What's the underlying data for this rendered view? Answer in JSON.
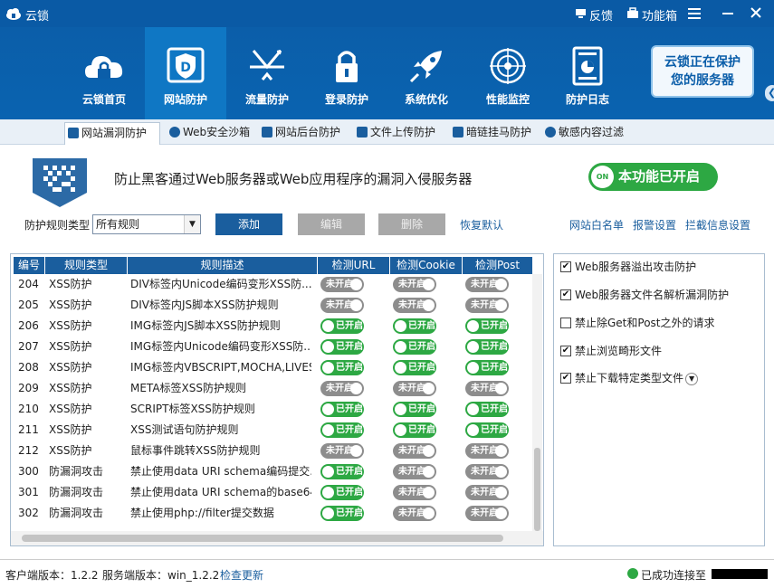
{
  "app": {
    "title": "云锁",
    "feedback": "反馈",
    "toolbox": "功能箱"
  },
  "nav": {
    "items": [
      {
        "label": "云锁首页",
        "icon": "cloud-lock-icon"
      },
      {
        "label": "网站防护",
        "icon": "website-shield-icon"
      },
      {
        "label": "流量防护",
        "icon": "traffic-icon"
      },
      {
        "label": "登录防护",
        "icon": "padlock-icon"
      },
      {
        "label": "系统优化",
        "icon": "rocket-icon"
      },
      {
        "label": "性能监控",
        "icon": "radar-icon"
      },
      {
        "label": "防护日志",
        "icon": "log-report-icon"
      }
    ],
    "protect_line1": "云锁正在保护",
    "protect_line2": "您的服务器"
  },
  "subtabs": [
    {
      "label": "网站漏洞防护"
    },
    {
      "label": "Web安全沙箱"
    },
    {
      "label": "网站后台防护"
    },
    {
      "label": "文件上传防护"
    },
    {
      "label": "暗链挂马防护"
    },
    {
      "label": "敏感内容过滤"
    }
  ],
  "banner": {
    "description": "防止黑客通过Web服务器或Web应用程序的漏洞入侵服务器",
    "toggle_dot": "ON",
    "toggle_label": "本功能已开启"
  },
  "toolbar": {
    "rule_type_label": "防护规则类型",
    "rule_type_value": "所有规则",
    "add": "添加",
    "edit": "编辑",
    "delete": "删除",
    "restore": "恢复默认",
    "whitelist": "网站白名单",
    "report": "报警设置",
    "intercept": "拦截信息设置"
  },
  "table": {
    "headers": [
      "编号",
      "规则类型",
      "规则描述",
      "检测URL",
      "检测Cookie",
      "检测Post"
    ],
    "rows": [
      {
        "id": "204",
        "type": "XSS防护",
        "desc": "DIV标签内Unicode编码变形XSS防...",
        "url": "未开启",
        "cookie": "未开启",
        "post": "未开启"
      },
      {
        "id": "205",
        "type": "XSS防护",
        "desc": "DIV标签内JS脚本XSS防护规则",
        "url": "未开启",
        "cookie": "未开启",
        "post": "未开启"
      },
      {
        "id": "206",
        "type": "XSS防护",
        "desc": "IMG标签内JS脚本XSS防护规则",
        "url": "已开启",
        "cookie": "已开启",
        "post": "已开启"
      },
      {
        "id": "207",
        "type": "XSS防护",
        "desc": "IMG标签内Unicode编码变形XSS防...",
        "url": "已开启",
        "cookie": "已开启",
        "post": "已开启"
      },
      {
        "id": "208",
        "type": "XSS防护",
        "desc": "IMG标签内VBSCRIPT,MOCHA,LIVES...",
        "url": "已开启",
        "cookie": "已开启",
        "post": "已开启"
      },
      {
        "id": "209",
        "type": "XSS防护",
        "desc": "META标签XSS防护规则",
        "url": "未开启",
        "cookie": "未开启",
        "post": "未开启"
      },
      {
        "id": "210",
        "type": "XSS防护",
        "desc": "SCRIPT标签XSS防护规则",
        "url": "已开启",
        "cookie": "已开启",
        "post": "已开启"
      },
      {
        "id": "211",
        "type": "XSS防护",
        "desc": "XSS测试语句防护规则",
        "url": "已开启",
        "cookie": "已开启",
        "post": "已开启"
      },
      {
        "id": "212",
        "type": "XSS防护",
        "desc": "鼠标事件跳转XSS防护规则",
        "url": "未开启",
        "cookie": "未开启",
        "post": "未开启"
      },
      {
        "id": "300",
        "type": "防漏洞攻击",
        "desc": "禁止使用data URI schema编码提交...",
        "url": "已开启",
        "cookie": "未开启",
        "post": "未开启"
      },
      {
        "id": "301",
        "type": "防漏洞攻击",
        "desc": "禁止使用data URI schema的base64...",
        "url": "已开启",
        "cookie": "未开启",
        "post": "未开启"
      },
      {
        "id": "302",
        "type": "防漏洞攻击",
        "desc": "禁止使用php://filter提交数据",
        "url": "已开启",
        "cookie": "未开启",
        "post": "未开启"
      }
    ]
  },
  "options": [
    {
      "label": "Web服务器溢出攻击防护",
      "checked": true
    },
    {
      "label": "Web服务器文件名解析漏洞防护",
      "checked": true
    },
    {
      "label": "禁止除Get和Post之外的请求",
      "checked": false
    },
    {
      "label": "禁止浏览畸形文件",
      "checked": true
    },
    {
      "label": "禁止下载特定类型文件",
      "checked": true
    }
  ],
  "status": {
    "client_version": "客户端版本：1.2.2",
    "server_version": "服务端版本：win_1.2.2",
    "check_update": "检查更新",
    "connected": "已成功连接至"
  },
  "colors": {
    "brand_blue": "#0a5aa5",
    "header_blue": "#1a5e9e",
    "on_green": "#2da843",
    "off_gray": "#8d8d8d"
  }
}
